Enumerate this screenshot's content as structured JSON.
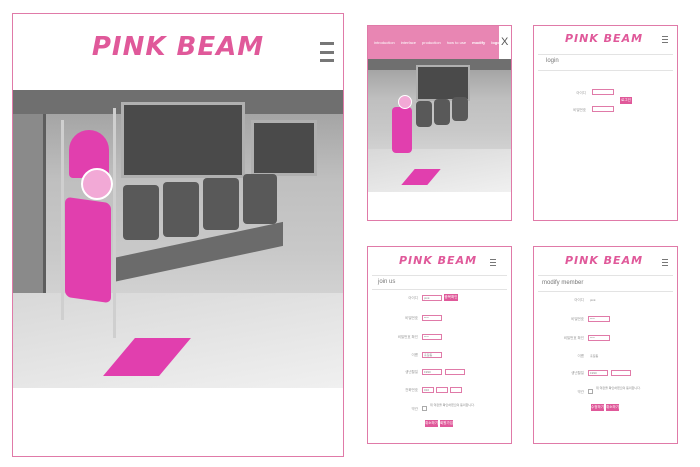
{
  "brand": {
    "logo": "PINK BEAM",
    "accent": "#e0599a",
    "border": "#e07aa8"
  },
  "icons": {
    "menu": "hamburger-icon",
    "close": "close-icon"
  },
  "panel_mobile_nav": {
    "nav_items": [
      "introduction",
      "interface",
      "production",
      "how to use",
      "modify",
      "logout"
    ],
    "close_label": "X"
  },
  "panel_login": {
    "title": "login",
    "id_label": "아이디",
    "pw_label": "비밀번호",
    "button": "로그인"
  },
  "panel_join": {
    "title": "join us",
    "fields": [
      {
        "label": "아이디",
        "value": "pink",
        "button": "중복확인"
      },
      {
        "label": "비밀번호",
        "value": "****"
      },
      {
        "label": "비밀번호 확인",
        "value": "****"
      },
      {
        "label": "이름",
        "value": "홍길동"
      },
      {
        "label": "생년월일",
        "value": "1990"
      },
      {
        "label": "전화번호",
        "value": "010"
      }
    ],
    "terms_label": "약관",
    "terms_text": "위 약관을 확인하였으며 동의합니다.",
    "submit": "회원가입",
    "cancel": "취소하기"
  },
  "panel_modify": {
    "title": "modify member",
    "fields": [
      {
        "label": "아이디",
        "value": "pink"
      },
      {
        "label": "비밀번호",
        "value": "****"
      },
      {
        "label": "비밀번호 확인",
        "value": "****"
      },
      {
        "label": "이름",
        "value": "홍길동"
      },
      {
        "label": "생년월일",
        "value": "1990"
      },
      {
        "label": "약관",
        "value": ""
      }
    ],
    "submit": "수정하기",
    "cancel": "취소하기"
  }
}
